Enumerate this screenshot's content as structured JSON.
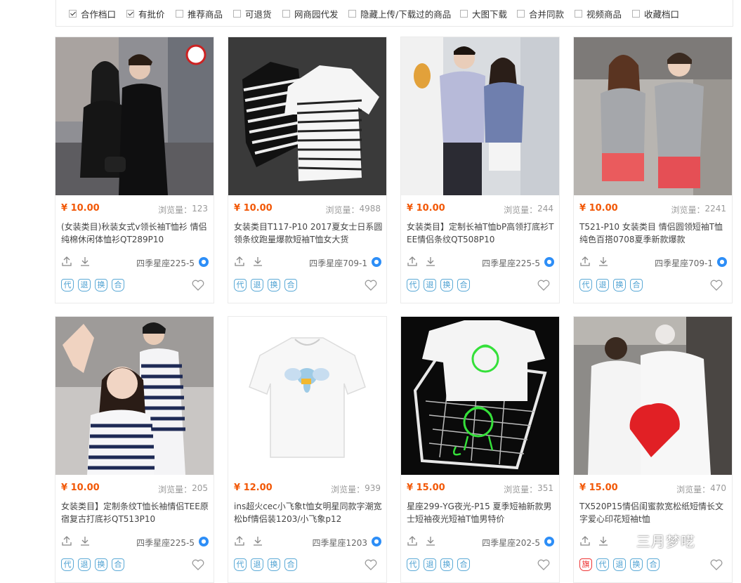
{
  "filters": [
    {
      "label": "合作档口",
      "checked": true
    },
    {
      "label": "有批价",
      "checked": true
    },
    {
      "label": "推荐商品",
      "checked": false
    },
    {
      "label": "可退货",
      "checked": false
    },
    {
      "label": "网商园代发",
      "checked": false
    },
    {
      "label": "隐藏上传/下载过的商品",
      "checked": false
    },
    {
      "label": "大图下载",
      "checked": false
    },
    {
      "label": "合并同款",
      "checked": false
    },
    {
      "label": "视频商品",
      "checked": false
    },
    {
      "label": "收藏档口",
      "checked": false
    }
  ],
  "views_label": "浏览量：",
  "products": [
    {
      "price": "¥ 10.00",
      "views": "123",
      "title": "(女装类目)秋装女式v领长袖T恤衫 情侣纯棉休闲体恤衫QT289P10",
      "store": "四季星座225-5",
      "tags": [
        "代",
        "退",
        "换",
        "合"
      ]
    },
    {
      "price": "¥ 10.00",
      "views": "4988",
      "title": "女装类目T117-P10 2017夏女士日系圆领条纹跑量爆款短袖T恤女大货",
      "store": "四季星座709-1",
      "tags": [
        "代",
        "退",
        "换",
        "合"
      ]
    },
    {
      "price": "¥ 10.00",
      "views": "244",
      "title": "女装类目】定制长袖T恤bP高领打底衫TEE情侣条纹QT508P10",
      "store": "四季星座225-5",
      "tags": [
        "代",
        "退",
        "换",
        "合"
      ]
    },
    {
      "price": "¥ 10.00",
      "views": "2241",
      "title": "T521-P10 女装类目 情侣圆领短袖T恤纯色百搭0708夏季新款爆款",
      "store": "四季星座709-1",
      "tags": [
        "代",
        "退",
        "换",
        "合"
      ]
    },
    {
      "price": "¥ 10.00",
      "views": "205",
      "title": "女装类目】定制条纹T恤长袖情侣TEE原宿复古打底衫QT513P10",
      "store": "四季星座225-5",
      "tags": [
        "代",
        "退",
        "换",
        "合"
      ]
    },
    {
      "price": "¥ 12.00",
      "views": "939",
      "title": "ins超火cec小飞象t恤女明星同款字潮宽松bf情侣装1203/小飞象p12",
      "store": "四季星座1203",
      "tags": [
        "代",
        "退",
        "换",
        "合"
      ]
    },
    {
      "price": "¥ 15.00",
      "views": "351",
      "title": "星座299-YG夜光-P15 夏季短袖新款男士短袖夜光短袖T恤男特价",
      "store": "四季星座202-5",
      "tags": [
        "代",
        "退",
        "换",
        "合"
      ]
    },
    {
      "price": "¥ 15.00",
      "views": "470",
      "title": "TX520P15情侣闺蜜款宽松纸短情长文字爱心印花短袖t恤",
      "store": "",
      "tags": [
        "旗",
        "代",
        "退",
        "换",
        "合"
      ]
    }
  ],
  "watermark": "三月梦呓"
}
